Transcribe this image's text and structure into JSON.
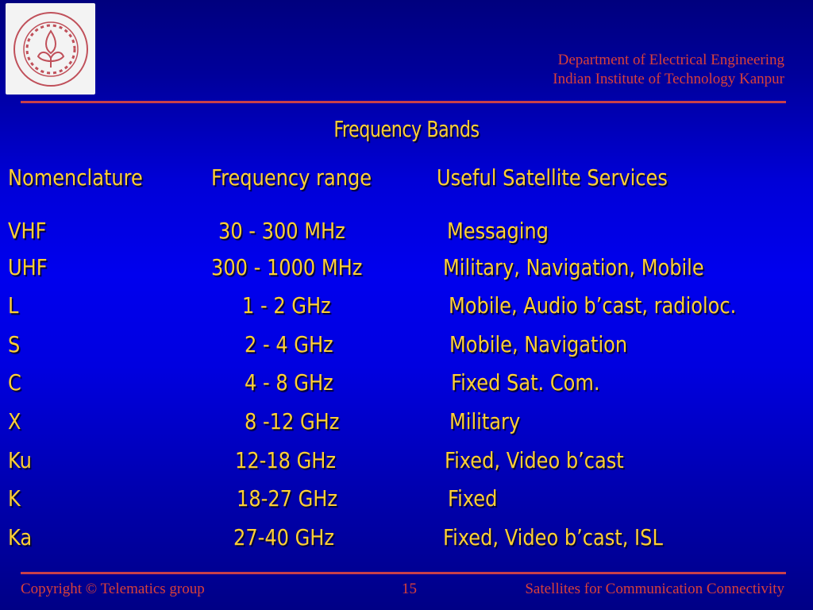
{
  "header": {
    "logo_alt": "IIT Kanpur emblem",
    "department_line1": "Department of Electrical Engineering",
    "department_line2": "Indian Institute of Technology Kanpur"
  },
  "slide": {
    "title": "Frequency Bands",
    "columns": [
      "Nomenclature",
      "Frequency range",
      "Useful Satellite Services"
    ],
    "rows": [
      {
        "band": "VHF",
        "range": "30 - 300 MHz",
        "services": "Messaging"
      },
      {
        "band": "UHF",
        "range": "300 - 1000 MHz",
        "services": "Military, Navigation, Mobile"
      },
      {
        "band": "L",
        "range": "1 - 2 GHz",
        "services": "Mobile, Audio b’cast, radioloc."
      },
      {
        "band": "S",
        "range": "2 - 4 GHz",
        "services": "Mobile, Navigation"
      },
      {
        "band": "C",
        "range": "4 - 8 GHz",
        "services": "Fixed Sat. Com."
      },
      {
        "band": "X",
        "range": "8 -12 GHz",
        "services": "Military"
      },
      {
        "band": "Ku",
        "range": "12-18 GHz",
        "services": "Fixed, Video b’cast"
      },
      {
        "band": "K",
        "range": "18-27 GHz",
        "services": "Fixed"
      },
      {
        "band": "Ka",
        "range": "27-40 GHz",
        "services": "Fixed, Video b’cast, ISL"
      }
    ]
  },
  "footer": {
    "copyright": "Copyright © Telematics group",
    "page_number": "15",
    "course_title": "Satellites for Communication Connectivity"
  },
  "colors": {
    "text_gold": "#ffd033",
    "header_red": "#d8403a",
    "rule_red": "#c8404a",
    "bg_navy": "#00007e",
    "bg_blue": "#0000ee"
  }
}
